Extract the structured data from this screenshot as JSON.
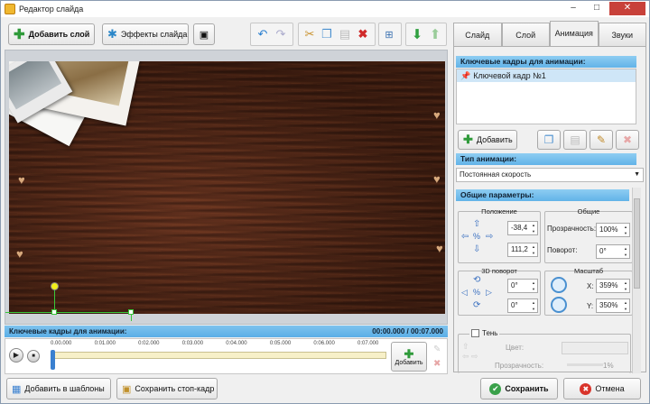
{
  "window": {
    "title": "Редактор слайда",
    "min": "–",
    "max": "□",
    "close": "✕"
  },
  "toolbar": {
    "add_layer": "Добавить слой",
    "slide_effects": "Эффекты слайда"
  },
  "tabs": [
    "Слайд",
    "Слой",
    "Анимация",
    "Звуки"
  ],
  "keyframes_panel": {
    "header": "Ключевые кадры для анимации:",
    "items": [
      "Ключевой кадр №1"
    ],
    "add_button": "Добавить"
  },
  "animation_type": {
    "header": "Тип анимации:",
    "value": "Постоянная скорость"
  },
  "general": {
    "header": "Общие параметры:",
    "position_caption": "Положение",
    "pos_x": "-38,4",
    "pos_y": "111,2",
    "common_caption": "Общие",
    "opacity_label": "Прозрачность:",
    "opacity_value": "100%",
    "rotation_label": "Поворот:",
    "rotation_value": "0°",
    "rot3d_caption": "3D поворот",
    "rot3d_a": "0°",
    "rot3d_b": "0°",
    "scale_caption": "Масштаб",
    "scale_x_label": "X:",
    "scale_x": "359%",
    "scale_y_label": "Y:",
    "scale_y": "350%"
  },
  "shadow": {
    "label": "Тень",
    "color_label": "Цвет:",
    "opacity_label": "Прозрачность:",
    "opacity_value": "1%"
  },
  "timeline": {
    "header": "Ключевые кадры для анимации:",
    "time": "00:00.000 / 00:07.000",
    "ticks": [
      "0.00.000",
      "0:01.000",
      "0:02.000",
      "0:03.000",
      "0:04.000",
      "0:05.000",
      "0:06.000",
      "0:07.000"
    ],
    "add_button": "Добавить",
    "playhead_fraction": 0
  },
  "bottom": {
    "add_to_templates": "Добавить в шаблоны",
    "save_still": "Сохранить стоп-кадр",
    "save": "Сохранить",
    "cancel": "Отмена"
  },
  "colors": {
    "accent": "#5aaee6",
    "save_green": "#3aa14a",
    "cancel_red": "#d9342b"
  }
}
